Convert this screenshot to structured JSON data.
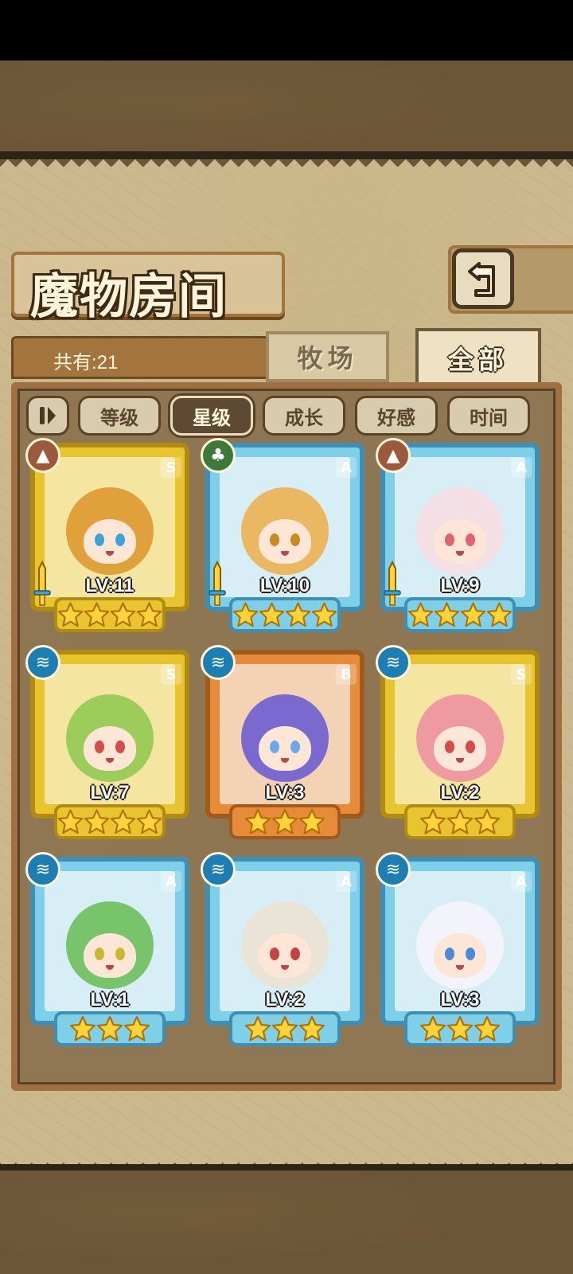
{
  "header": {
    "title": "魔物房间"
  },
  "summary": {
    "count_label": "共有:21"
  },
  "tabs": [
    {
      "label": "牧场",
      "active": false
    },
    {
      "label": "全部",
      "active": true
    }
  ],
  "filters": [
    {
      "label": "等级",
      "active": false
    },
    {
      "label": "星级",
      "active": true
    },
    {
      "label": "成长",
      "active": false
    },
    {
      "label": "好感",
      "active": false
    },
    {
      "label": "时间",
      "active": false
    }
  ],
  "icons": {
    "back": "back-arrow-icon",
    "sort_toggle": "sort-order-icon"
  },
  "colors": {
    "gold_frame": "#e8c42f",
    "blue_frame": "#7ed0e8",
    "orange_frame": "#e58b3a",
    "panel": "#cbb88d"
  },
  "monsters": [
    {
      "level": "LV:11",
      "rank": "S",
      "element": "earth",
      "frame": "gold",
      "stars": 4,
      "weapon": true,
      "hair": "#e0a13a",
      "eye": "#3aa3d8"
    },
    {
      "level": "LV:10",
      "rank": "A",
      "element": "wind",
      "frame": "blue",
      "stars": 4,
      "weapon": true,
      "hair": "#e9b861",
      "eye": "#c98b20"
    },
    {
      "level": "LV:9",
      "rank": "A",
      "element": "earth",
      "frame": "blue",
      "stars": 4,
      "weapon": true,
      "hair": "#f4dfe4",
      "eye": "#e0626e"
    },
    {
      "level": "LV:7",
      "rank": "S",
      "element": "water",
      "frame": "gold",
      "stars": 4,
      "weapon": false,
      "hair": "#9ccc5a",
      "eye": "#d64a4a"
    },
    {
      "level": "LV:3",
      "rank": "B",
      "element": "water",
      "frame": "orange",
      "stars": 3,
      "weapon": false,
      "hair": "#7a6ad0",
      "eye": "#6aa8e8"
    },
    {
      "level": "LV:2",
      "rank": "S",
      "element": "water",
      "frame": "gold",
      "stars": 3,
      "weapon": false,
      "hair": "#ef9aa0",
      "eye": "#d64a4a"
    },
    {
      "level": "LV:1",
      "rank": "A",
      "element": "water",
      "frame": "blue",
      "stars": 3,
      "weapon": false,
      "hair": "#78c46a",
      "eye": "#c8b830"
    },
    {
      "level": "LV:2",
      "rank": "A",
      "element": "water",
      "frame": "blue",
      "stars": 3,
      "weapon": false,
      "hair": "#e9e4d6",
      "eye": "#c84040"
    },
    {
      "level": "LV:3",
      "rank": "A",
      "element": "water",
      "frame": "blue",
      "stars": 3,
      "weapon": false,
      "hair": "#f3f3fb",
      "eye": "#4a8ad8"
    }
  ]
}
